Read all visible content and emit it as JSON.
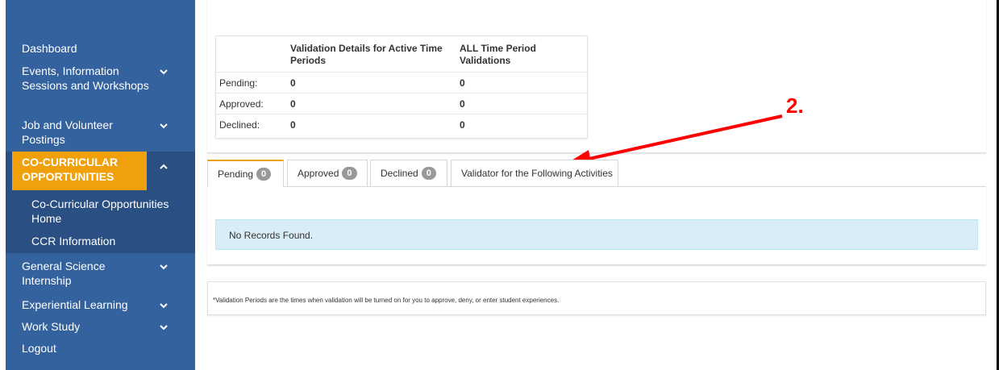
{
  "sidebar": {
    "items": [
      {
        "label": "Dashboard"
      },
      {
        "label": "Events, Information Sessions and Workshops"
      },
      {
        "label": "Job and Volunteer Postings"
      },
      {
        "label": "CO-CURRICULAR OPPORTUNITIES"
      },
      {
        "label": "General Science Internship"
      },
      {
        "label": "Experiential Learning"
      },
      {
        "label": "Work Study"
      },
      {
        "label": "Logout"
      }
    ],
    "subitems": [
      {
        "label": "Co-Curricular Opportunities Home"
      },
      {
        "label": "CCR Information"
      }
    ]
  },
  "summary": {
    "headers": [
      "",
      "Validation Details for Active Time Periods",
      "ALL Time Period Validations"
    ],
    "rows": [
      {
        "label": "Pending:",
        "active": "0",
        "all": "0"
      },
      {
        "label": "Approved:",
        "active": "0",
        "all": "0"
      },
      {
        "label": "Declined:",
        "active": "0",
        "all": "0"
      }
    ]
  },
  "annotation": {
    "label": "2."
  },
  "tabs": [
    {
      "label": "Pending",
      "count": "0"
    },
    {
      "label": "Approved",
      "count": "0"
    },
    {
      "label": "Declined",
      "count": "0"
    },
    {
      "label": "Validator for the Following Activities"
    }
  ],
  "list": {
    "empty_message": "No Records Found."
  },
  "note": "*Validation Periods are the times when validation will be turned on for you to approve, deny, or enter student experiences.",
  "colors": {
    "sidebar": "#34629e",
    "accent": "#f0a00a",
    "annotation": "#ff0000",
    "info_bg": "#d9edf7"
  }
}
